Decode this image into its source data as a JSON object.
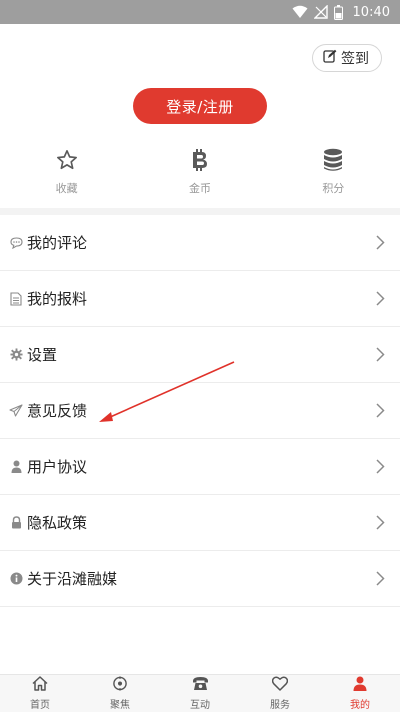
{
  "status_bar": {
    "time": "10:40"
  },
  "header": {
    "checkin_label": "签到",
    "login_label": "登录/注册"
  },
  "quick": [
    {
      "label": "收藏"
    },
    {
      "label": "金币"
    },
    {
      "label": "积分"
    }
  ],
  "menu": [
    {
      "label": "我的评论"
    },
    {
      "label": "我的报料"
    },
    {
      "label": "设置"
    },
    {
      "label": "意见反馈"
    },
    {
      "label": "用户协议"
    },
    {
      "label": "隐私政策"
    },
    {
      "label": "关于沿滩融媒"
    }
  ],
  "tabs": [
    {
      "label": "首页"
    },
    {
      "label": "聚焦"
    },
    {
      "label": "互动"
    },
    {
      "label": "服务"
    },
    {
      "label": "我的"
    }
  ],
  "colors": {
    "accent": "#e03a2f",
    "icon_gray": "#5a5a5a",
    "muted": "#999999"
  }
}
